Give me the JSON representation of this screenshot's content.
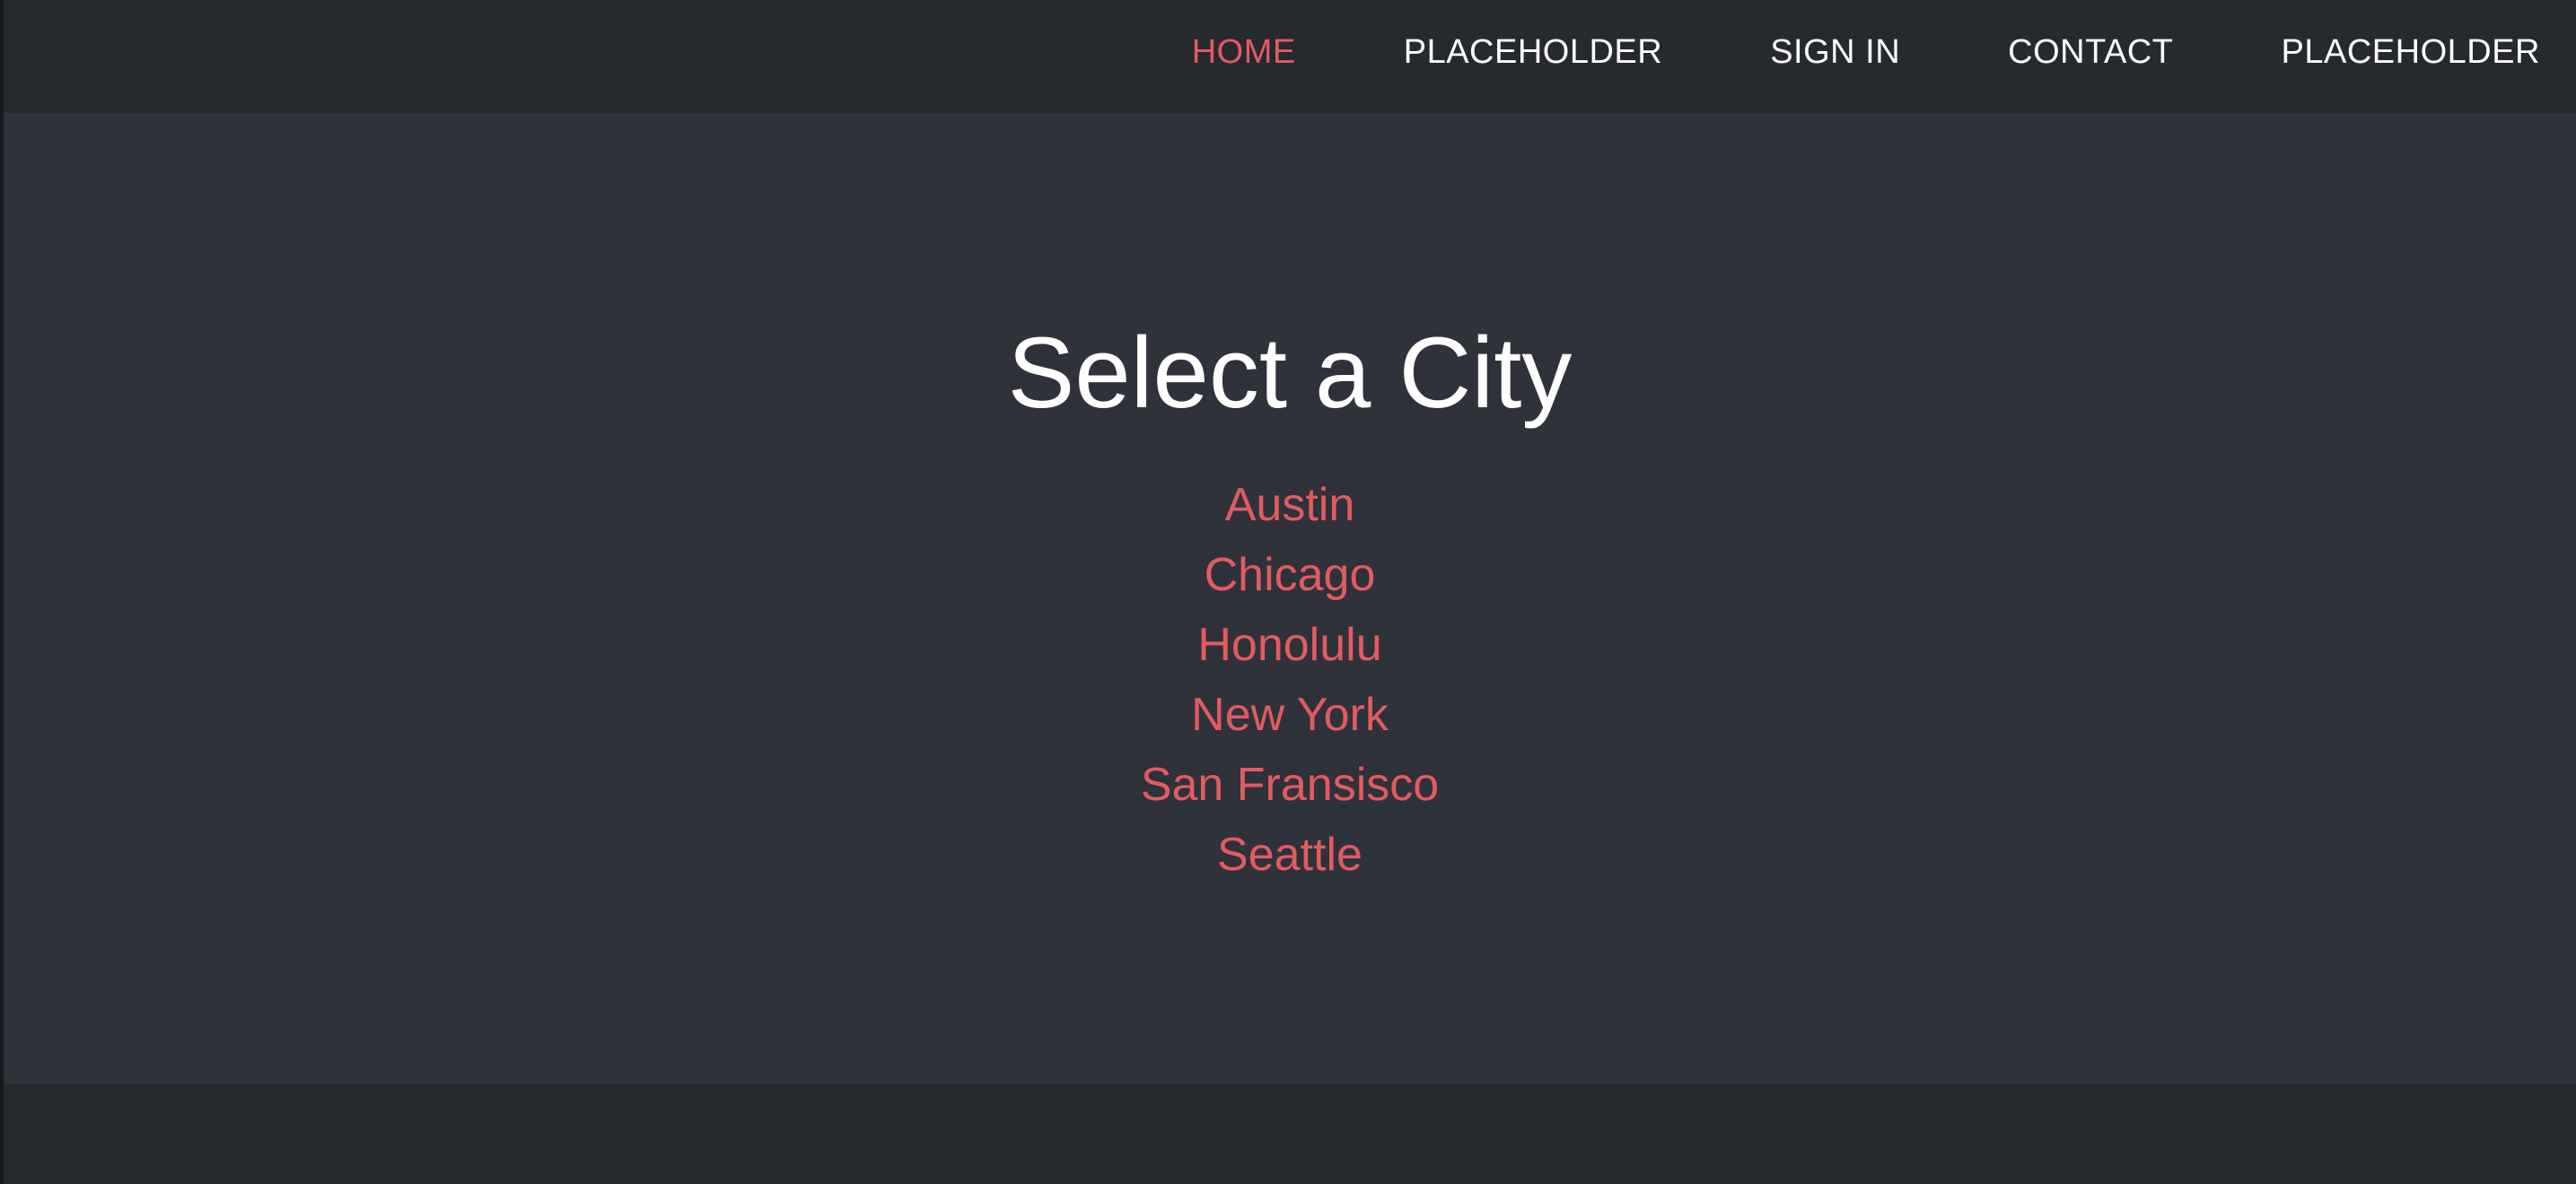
{
  "nav": {
    "items": [
      {
        "label": "HOME",
        "active": true
      },
      {
        "label": "PLACEHOLDER",
        "active": false
      },
      {
        "label": "SIGN IN",
        "active": false
      },
      {
        "label": "CONTACT",
        "active": false
      },
      {
        "label": "PLACEHOLDER",
        "active": false
      }
    ]
  },
  "main": {
    "title": "Select a City",
    "cities": [
      "Austin",
      "Chicago",
      "Honolulu",
      "New York",
      "San Fransisco",
      "Seattle"
    ]
  },
  "colors": {
    "accent": "#e25b62",
    "nav_background": "#26292e",
    "main_background": "#2f323a",
    "text": "#ffffff"
  }
}
